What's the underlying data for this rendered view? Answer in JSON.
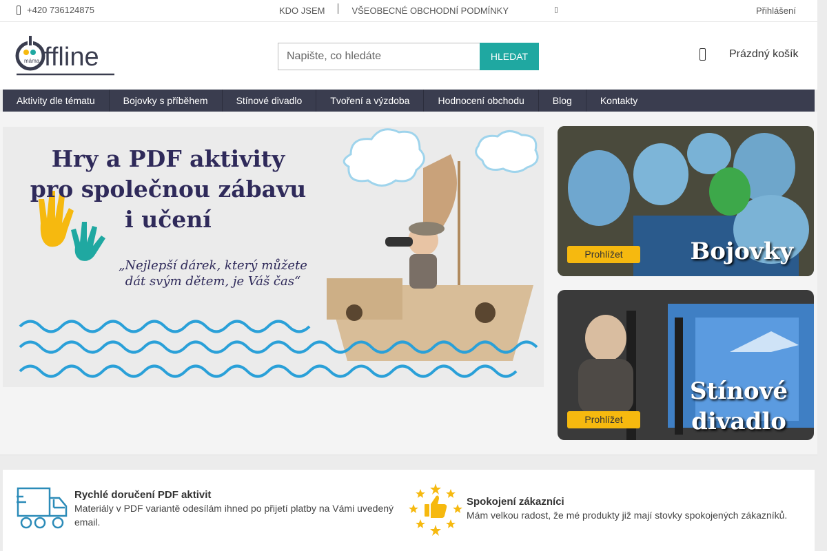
{
  "topbar": {
    "phone": "+420 736124875",
    "link_about": "KDO JSEM",
    "link_terms": "VŠEOBECNÉ OBCHODNÍ PODMÍNKY",
    "login": "Přihlášení"
  },
  "logo": {
    "text": "ffline",
    "small": "máma"
  },
  "search": {
    "placeholder": "Napište, co hledáte",
    "button": "HLEDAT"
  },
  "cart": {
    "label": "Prázdný košík"
  },
  "nav": {
    "items": [
      {
        "label": "Aktivity dle tématu"
      },
      {
        "label": "Bojovky s příběhem"
      },
      {
        "label": "Stínové divadlo"
      },
      {
        "label": "Tvoření a výzdoba"
      },
      {
        "label": "Hodnocení obchodu"
      },
      {
        "label": "Blog"
      },
      {
        "label": "Kontakty"
      }
    ]
  },
  "hero": {
    "title_line1": "Hry a PDF aktivity",
    "title_line2": "pro společnou zábavu",
    "title_line3": "i učení",
    "quote_line1": "„Nejlepší dárek, který můžete",
    "quote_line2": "dát svým dětem, je Váš čas“"
  },
  "promos": [
    {
      "button": "Prohlížet",
      "title": "Bojovky",
      "title2": ""
    },
    {
      "button": "Prohlížet",
      "title": "Stínové",
      "title2": "divadlo"
    }
  ],
  "benefits": [
    {
      "title": "Rychlé doručení PDF aktivit",
      "text_line1": "Materiály v PDF variantě odesílám ihned po přijetí platby na Vámi uvedený",
      "text_line2": "email."
    },
    {
      "title": "Spokojení zákazníci",
      "text_line1": "Mám velkou radost, že mé produkty již mají stovky spokojených zákazníků.",
      "text_line2": ""
    }
  ],
  "colors": {
    "accent": "#1fa8a1",
    "nav": "#3a3d4f",
    "button_yellow": "#f6b90f",
    "heading": "#2f2a5a"
  },
  "icons": {
    "phone": "phone-icon",
    "cart": "cart-icon",
    "truck": "truck-icon",
    "thumb": "thumbs-up-icon"
  }
}
